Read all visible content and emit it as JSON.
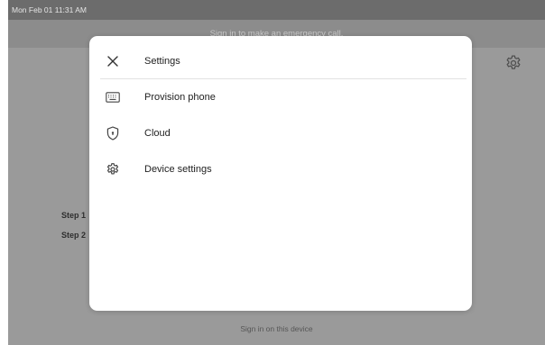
{
  "status_bar": {
    "datetime": "Mon Feb 01  11:31 AM"
  },
  "banner": {
    "text": "Sign in to make an emergency call."
  },
  "background": {
    "settings_icon": "gear-icon",
    "steps": [
      "Step 1",
      "Step 2"
    ],
    "sign_in_link": "Sign in on this device"
  },
  "dialog": {
    "close_icon": "close-icon",
    "title": "Settings",
    "items": [
      {
        "label": "Provision phone",
        "icon": "keyboard-icon"
      },
      {
        "label": "Cloud",
        "icon": "shield-icon"
      },
      {
        "label": "Device settings",
        "icon": "gear-icon"
      }
    ]
  }
}
